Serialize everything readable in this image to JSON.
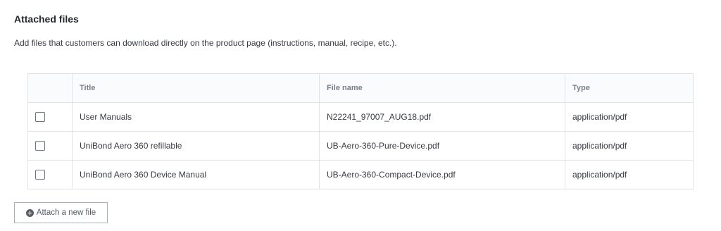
{
  "section": {
    "title": "Attached files",
    "description": "Add files that customers can download directly on the product page (instructions, manual, recipe, etc.)."
  },
  "table": {
    "headers": {
      "title": "Title",
      "file_name": "File name",
      "type": "Type"
    },
    "rows": [
      {
        "title": "User Manuals",
        "file_name": "N22241_97007_AUG18.pdf",
        "type": "application/pdf",
        "checked": false
      },
      {
        "title": "UniBond Aero 360 refillable",
        "file_name": "UB-Aero-360-Pure-Device.pdf",
        "type": "application/pdf",
        "checked": false
      },
      {
        "title": "UniBond Aero 360 Device Manual",
        "file_name": "UB-Aero-360-Compact-Device.pdf",
        "type": "application/pdf",
        "checked": false
      }
    ]
  },
  "attach_button": {
    "label": "Attach a new file",
    "icon": "plus-circle-icon"
  }
}
